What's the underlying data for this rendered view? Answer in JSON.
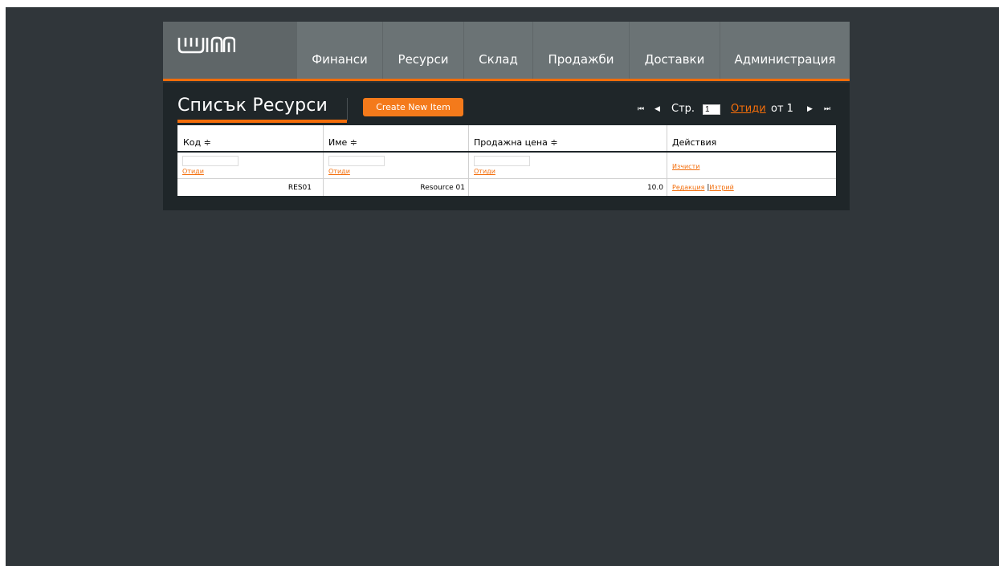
{
  "nav": {
    "items": [
      {
        "label": "Финанси"
      },
      {
        "label": "Ресурси"
      },
      {
        "label": "Склад"
      },
      {
        "label": "Продажби"
      },
      {
        "label": "Доставки"
      },
      {
        "label": "Администрация"
      }
    ]
  },
  "page": {
    "title": "Списък Ресурси",
    "create_button": "Create New Item"
  },
  "pager": {
    "first_icon": "first-page-icon",
    "prev_icon": "prev-page-icon",
    "next_icon": "next-page-icon",
    "last_icon": "last-page-icon",
    "page_label": "Стр.",
    "page_value": "1",
    "go_label": "Отиди",
    "of_label": "от 1"
  },
  "table": {
    "columns": [
      {
        "label": "Код ≑"
      },
      {
        "label": "Име ≑"
      },
      {
        "label": "Продажна цена ≑"
      },
      {
        "label": "Действия"
      }
    ],
    "filter_go": "Отиди",
    "clear_label": "Изчисти",
    "rows": [
      {
        "code": "RES01",
        "name": "Resource 01",
        "price": "10.0",
        "edit": "Редакция",
        "sep": "|",
        "delete": "Изтрий"
      }
    ]
  },
  "colors": {
    "accent": "#f36d0a",
    "background": "#30363a",
    "panel": "#1f2629",
    "nav": "#6b7375"
  }
}
